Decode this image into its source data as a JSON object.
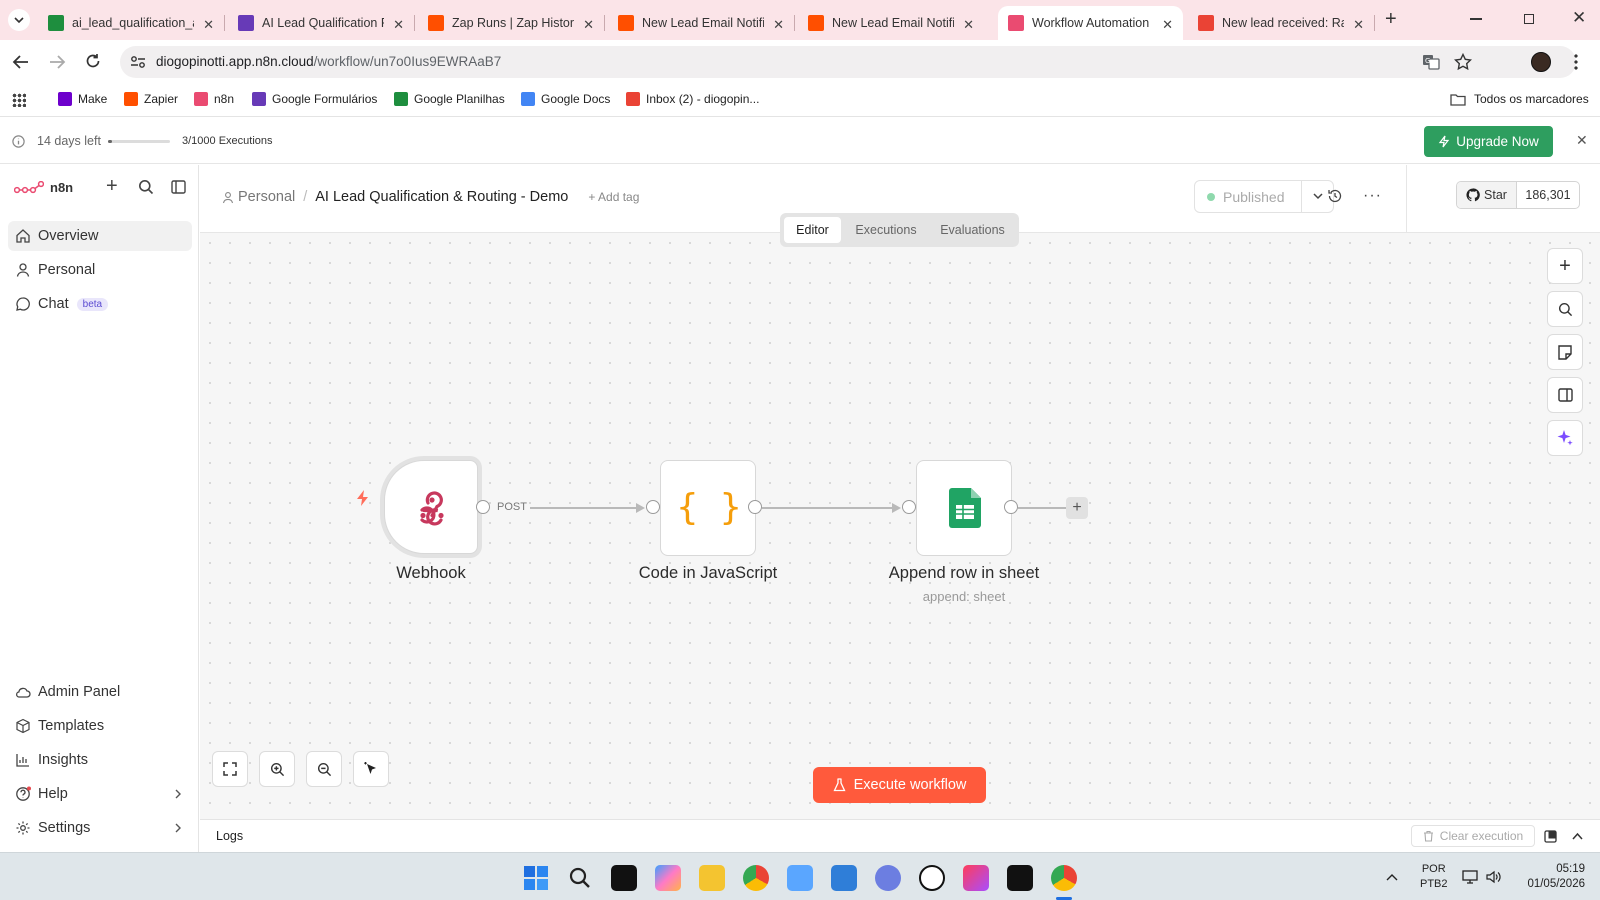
{
  "browser": {
    "tabs": [
      {
        "title": "ai_lead_qualification_a",
        "favicon": "sheets-icon",
        "color": "#1e8e3e"
      },
      {
        "title": "AI Lead Qualification F",
        "favicon": "forms-icon",
        "color": "#673ab7"
      },
      {
        "title": "Zap Runs | Zap History",
        "favicon": "zapier-icon",
        "color": "#ff4f00"
      },
      {
        "title": "New Lead Email Notific",
        "favicon": "zapier-icon",
        "color": "#ff4f00"
      },
      {
        "title": "New Lead Email Notific",
        "favicon": "zapier-icon",
        "color": "#ff4f00"
      },
      {
        "title": "Workflow Automation",
        "favicon": "n8n-icon",
        "color": "#ea4b71",
        "active": true
      },
      {
        "title": "New lead received: Raf",
        "favicon": "gmail-icon",
        "color": "#ea4335"
      }
    ],
    "url_host": "diogopinotti.app.n8n.cloud",
    "url_path": "/workflow/un7o0Ius9EWRAaB7",
    "bookmarks": [
      {
        "label": "Make",
        "color": "#6d00cc"
      },
      {
        "label": "Zapier",
        "color": "#ff4f00"
      },
      {
        "label": "n8n",
        "color": "#ea4b71"
      },
      {
        "label": "Google Formulários",
        "color": "#673ab7"
      },
      {
        "label": "Google Planilhas",
        "color": "#1e8e3e"
      },
      {
        "label": "Google Docs",
        "color": "#4285f4"
      },
      {
        "label": "Inbox (2) - diogopin...",
        "color": "#ea4335"
      }
    ],
    "all_bookmarks": "Todos os marcadores"
  },
  "trial": {
    "days_left": "14 days left",
    "executions": "3/1000 Executions",
    "executions_progress": 0.003,
    "upgrade": "Upgrade Now"
  },
  "sidebar": {
    "brand": "n8n",
    "nav": [
      {
        "label": "Overview",
        "icon": "home-icon"
      },
      {
        "label": "Personal",
        "icon": "user-icon"
      },
      {
        "label": "Chat",
        "icon": "chat-icon",
        "badge": "beta"
      }
    ],
    "bottom": [
      {
        "label": "Admin Panel",
        "icon": "cloud-icon"
      },
      {
        "label": "Templates",
        "icon": "box-icon"
      },
      {
        "label": "Insights",
        "icon": "bar-chart-icon"
      },
      {
        "label": "Help",
        "icon": "help-icon"
      },
      {
        "label": "Settings",
        "icon": "gear-icon"
      }
    ]
  },
  "header": {
    "breadcrumb_project": "Personal",
    "separator": "/",
    "workflow_name": "AI Lead Qualification & Routing - Demo",
    "add_tag": "+ Add tag",
    "status": "Published",
    "star": "Star",
    "star_count": "186,301",
    "tabs": [
      "Editor",
      "Executions",
      "Evaluations"
    ],
    "active_tab": "Editor"
  },
  "nodes": [
    {
      "name": "Webhook",
      "subtitle": "",
      "icon": "webhook-icon",
      "output_label": "POST"
    },
    {
      "name": "Code in JavaScript",
      "subtitle": "",
      "icon": "code-braces-icon",
      "glyph": "{ }"
    },
    {
      "name": "Append row in sheet",
      "subtitle": "append: sheet",
      "icon": "sheets-icon"
    }
  ],
  "canvas": {
    "execute_button": "Execute workflow"
  },
  "logs": {
    "title": "Logs",
    "clear": "Clear execution"
  },
  "system": {
    "lang1": "POR",
    "lang2": "PTB2",
    "time": "05:19",
    "date": "01/05/2026"
  }
}
